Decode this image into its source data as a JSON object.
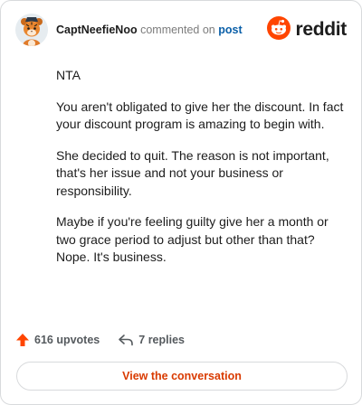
{
  "header": {
    "username": "CaptNeefieNoo",
    "action_text": "commented on",
    "post_link": "post",
    "brand_name": "reddit",
    "avatar_icon": "tiger-avatar-icon",
    "logo_icon": "reddit-snoo-logo-icon"
  },
  "comment": {
    "paragraphs": [
      "NTA",
      "You aren't obligated to give her the discount. In fact your discount program is amazing to begin with.",
      "She decided to quit. The reason is not important, that's her issue and not your business or responsibility.",
      "Maybe if you're feeling guilty give her a month or two grace period to adjust but other than that? Nope. It's business."
    ]
  },
  "footer": {
    "upvotes": "616 upvotes",
    "replies": "7 replies",
    "upvote_icon": "upvote-arrow-icon",
    "reply_icon": "reply-arrow-icon"
  },
  "cta": {
    "label": "View the conversation"
  },
  "colors": {
    "brand_orange": "#ff4500",
    "link_blue": "#0a5fa8",
    "cta_text": "#d93a00",
    "border": "#d8dadc"
  }
}
